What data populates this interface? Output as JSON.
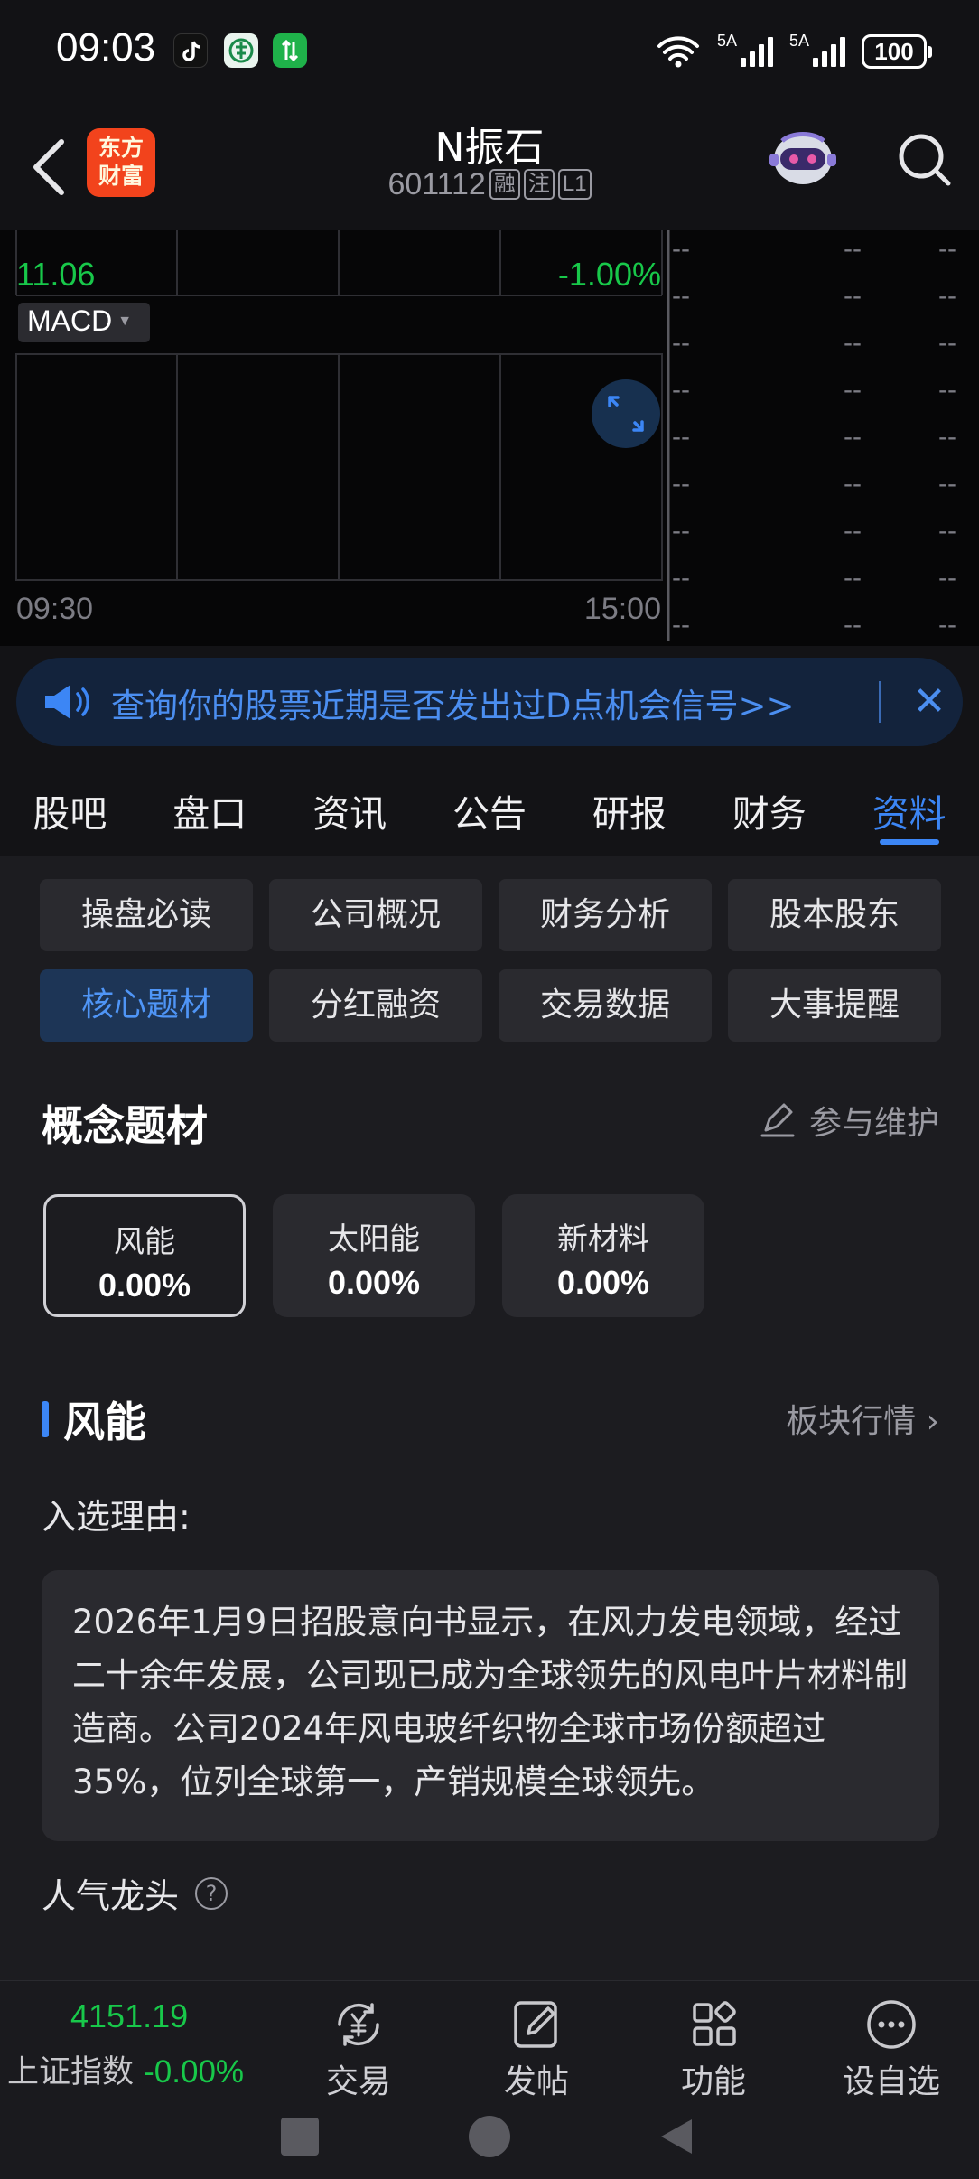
{
  "status_bar": {
    "time": "09:03",
    "signal_label_1": "5A",
    "signal_label_2": "5A",
    "battery": "100",
    "icons": [
      "tiktok-icon",
      "bank-app-icon",
      "transfer-app-icon",
      "wifi-icon",
      "signal-icon",
      "battery-icon"
    ]
  },
  "header": {
    "app_logo_line1": "东方",
    "app_logo_line2": "财富",
    "title": "N振石",
    "code": "601112",
    "tags": [
      "融",
      "注",
      "L1"
    ]
  },
  "chart": {
    "price": "11.06",
    "change_pct": "-1.00%",
    "indicator": "MACD",
    "time_start": "09:30",
    "time_end": "15:00",
    "orderbook_placeholder": "--",
    "colors": {
      "up_down": "#18c84a",
      "background": "#060607"
    }
  },
  "banner": {
    "text": "查询你的股票近期是否发出过D点机会信号>>",
    "close": "✕"
  },
  "tabs": [
    {
      "label": "股吧"
    },
    {
      "label": "盘口"
    },
    {
      "label": "资讯"
    },
    {
      "label": "公告"
    },
    {
      "label": "研报"
    },
    {
      "label": "财务"
    },
    {
      "label": "资料",
      "active": true
    }
  ],
  "chips": [
    {
      "label": "操盘必读"
    },
    {
      "label": "公司概况"
    },
    {
      "label": "财务分析"
    },
    {
      "label": "股本股东"
    },
    {
      "label": "核心题材",
      "active": true
    },
    {
      "label": "分红融资"
    },
    {
      "label": "交易数据"
    },
    {
      "label": "大事提醒"
    }
  ],
  "concept_section": {
    "title": "概念题材",
    "maintain": "参与维护",
    "concepts": [
      {
        "name": "风能",
        "value": "0.00%",
        "selected": true
      },
      {
        "name": "太阳能",
        "value": "0.00%"
      },
      {
        "name": "新材料",
        "value": "0.00%"
      }
    ]
  },
  "detail": {
    "title": "风能",
    "sector_link": "板块行情 ›",
    "reason_label": "入选理由:",
    "reason_text": "2026年1月9日招股意向书显示，在风力发电领域，经过二十余年发展，公司现已成为全球领先的风电叶片材料制造商。公司2024年风电玻纤织物全球市场份额超过35%，位列全球第一，产销规模全球领先。",
    "hot_label": "人气龙头",
    "help": "?"
  },
  "bottom_nav": {
    "index_value": "4151.19",
    "index_name": "上证指数",
    "index_change": "-0.00%",
    "items": [
      {
        "label": "交易",
        "icon": "trade-yen-icon"
      },
      {
        "label": "发帖",
        "icon": "compose-icon"
      },
      {
        "label": "功能",
        "icon": "grid-icon"
      },
      {
        "label": "设自选",
        "icon": "more-dots-icon"
      }
    ]
  },
  "accent_color": "#3c86f5"
}
